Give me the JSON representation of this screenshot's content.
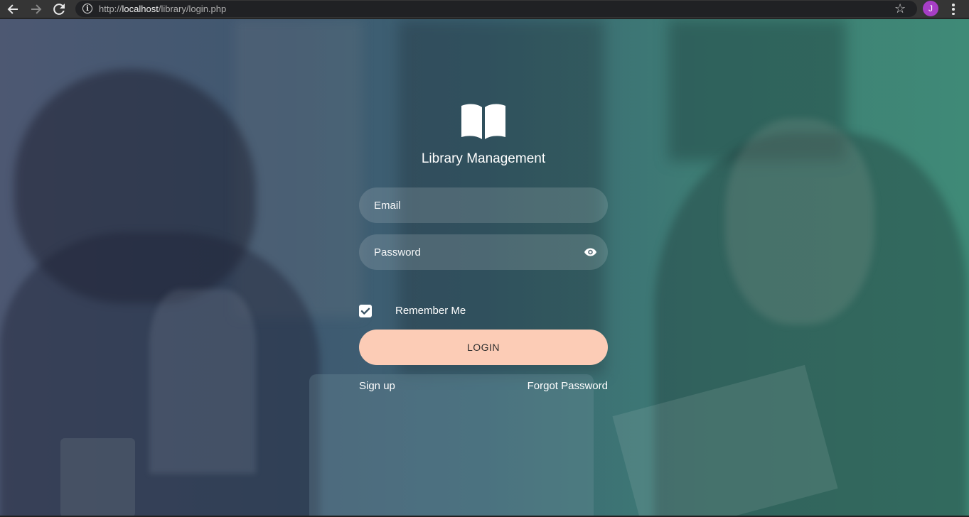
{
  "browser": {
    "url_prefix": "http://",
    "url_host": "localhost",
    "url_path": "/library/login.php",
    "avatar_initial": "J",
    "avatar_color": "#a63ec5"
  },
  "login": {
    "title": "Library Management",
    "email_placeholder": "Email",
    "password_placeholder": "Password",
    "remember_label": "Remember Me",
    "remember_checked": true,
    "login_label": "LOGIN",
    "signup_label": "Sign up",
    "forgot_label": "Forgot Password"
  },
  "colors": {
    "login_button": "#fcccb6",
    "overlay_left": "#4d5872",
    "overlay_right": "#3f8a77"
  },
  "icons": [
    "back-icon",
    "forward-icon",
    "reload-icon",
    "info-icon",
    "bookmark-star-icon",
    "menu-icon",
    "book-icon",
    "eye-icon",
    "checkmark-icon"
  ]
}
